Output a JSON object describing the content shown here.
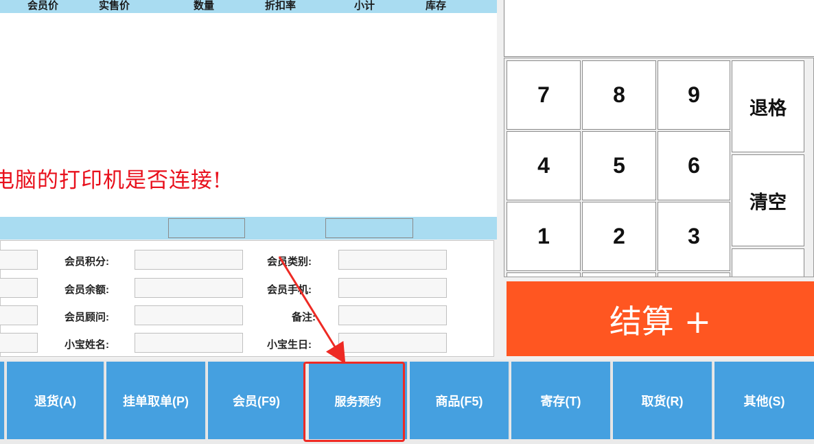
{
  "table": {
    "columns": [
      "会员价",
      "实售价",
      "数量",
      "折扣率",
      "小计",
      "库存"
    ]
  },
  "message": "电脑的打印机是否连接!",
  "member": {
    "points_label": "会员积分:",
    "type_label": "会员类别:",
    "balance_label": "会员余额:",
    "phone_label": "会员手机:",
    "advisor_label": "会员顾问:",
    "remark_label": "备注:",
    "baby_name_label": "小宝姓名:",
    "baby_birthday_label": "小宝生日:"
  },
  "keypad": {
    "k7": "7",
    "k8": "8",
    "k9": "9",
    "k4": "4",
    "k5": "5",
    "k6": "6",
    "k1": "1",
    "k2": "2",
    "k3": "3",
    "backspace": "退格",
    "clear": "清空"
  },
  "checkout_label": "结算 +",
  "bottom": {
    "return": "退货(A)",
    "hold": "挂单取单(P)",
    "member": "会员(F9)",
    "booking": "服务预约",
    "goods": "商品(F5)",
    "deposit": "寄存(T)",
    "pickup": "取货(R)",
    "other": "其他(S)"
  },
  "colors": {
    "header_bg": "#a9dcf1",
    "button_blue": "#45a0e0",
    "checkout_orange": "#ff5621",
    "alert_red": "#e8101c",
    "highlight_red": "#ee2a24"
  }
}
